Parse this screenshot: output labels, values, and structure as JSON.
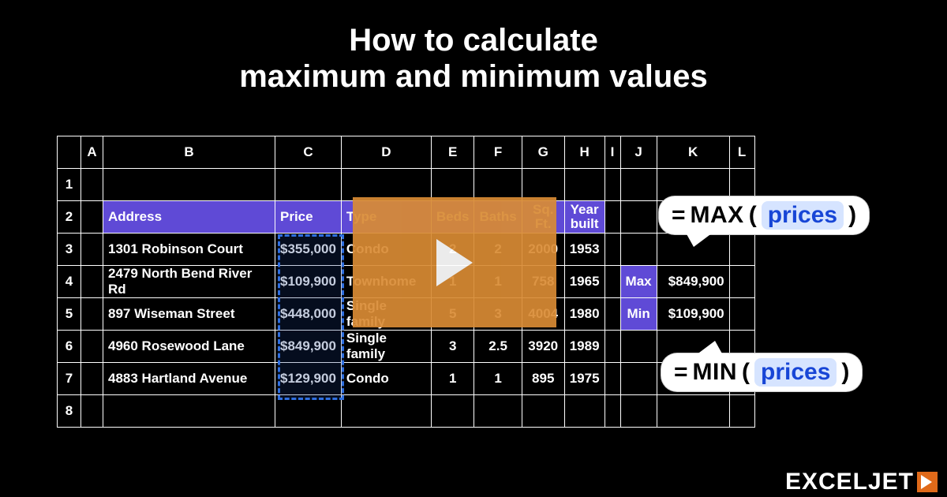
{
  "title_l1": "How to calculate",
  "title_l2": "maximum and minimum values",
  "cols": [
    "A",
    "B",
    "C",
    "D",
    "E",
    "F",
    "G",
    "H",
    "I",
    "J",
    "K",
    "L"
  ],
  "rows": [
    "1",
    "2",
    "3",
    "4",
    "5",
    "6",
    "7",
    "8"
  ],
  "headers": {
    "address": "Address",
    "price": "Price",
    "type": "Type",
    "beds": "Beds",
    "baths": "Baths",
    "sqft": "Sq. Ft.",
    "year": "Year built"
  },
  "data": {
    "r3": {
      "addr": "1301 Robinson Court",
      "price": "$355,000",
      "type": "Condo",
      "beds": "2",
      "baths": "2",
      "sqft": "2000",
      "year": "1953"
    },
    "r4": {
      "addr": "2479 North Bend River Rd",
      "price": "$109,900",
      "type": "Townhome",
      "beds": "1",
      "baths": "1",
      "sqft": "758",
      "year": "1965"
    },
    "r5": {
      "addr": "897 Wiseman Street",
      "price": "$448,000",
      "type": "Single family",
      "beds": "5",
      "baths": "3",
      "sqft": "4004",
      "year": "1980"
    },
    "r6": {
      "addr": "4960 Rosewood Lane",
      "price": "$849,900",
      "type": "Single family",
      "beds": "3",
      "baths": "2.5",
      "sqft": "3920",
      "year": "1989"
    },
    "r7": {
      "addr": "4883 Hartland Avenue",
      "price": "$129,900",
      "type": "Condo",
      "beds": "1",
      "baths": "1",
      "sqft": "895",
      "year": "1975"
    }
  },
  "side": {
    "max_label": "Max",
    "max_val": "$849,900",
    "min_label": "Min",
    "min_val": "$109,900"
  },
  "formulas": {
    "max_eq": "=",
    "max_fn": "MAX",
    "max_open": "(",
    "max_arg": "prices",
    "max_close": ")",
    "min_eq": "=",
    "min_fn": "MIN",
    "min_open": "(",
    "min_arg": "prices",
    "min_close": ")"
  },
  "brand": "EXCELJET"
}
